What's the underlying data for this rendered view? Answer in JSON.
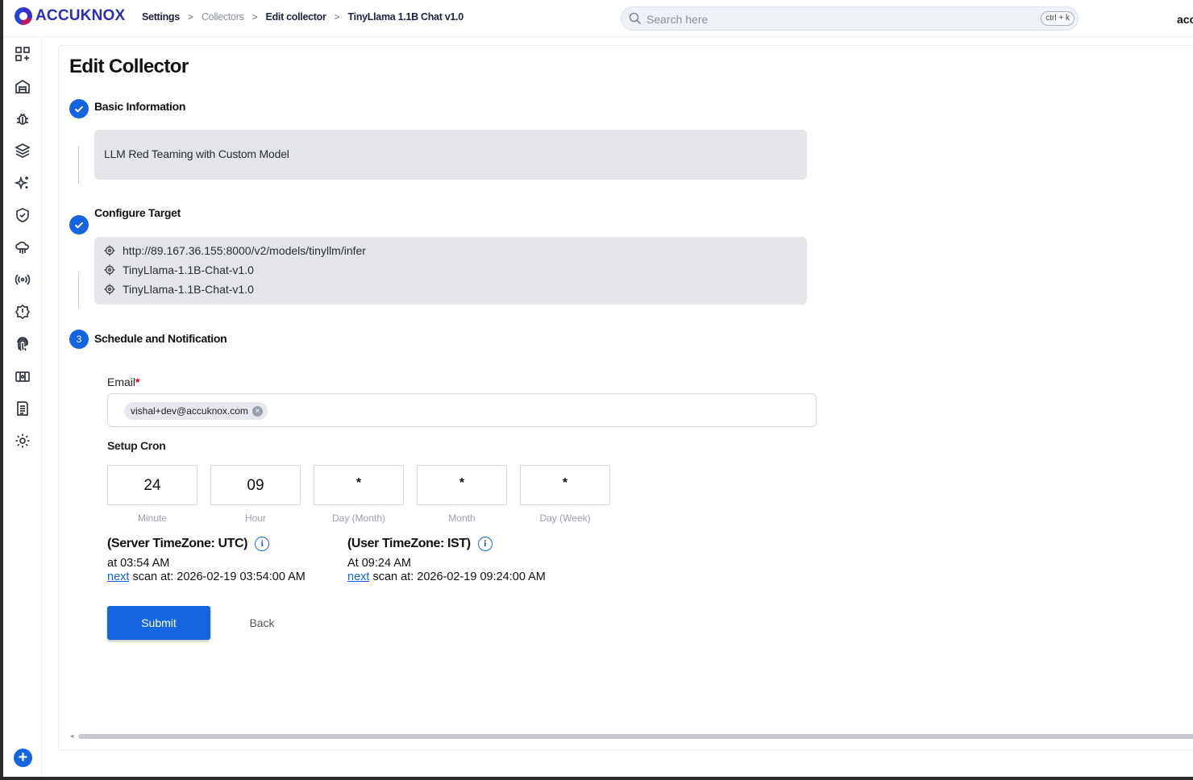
{
  "app": {
    "logo_text": "ACCUKNOX",
    "user_name": "acc"
  },
  "breadcrumb": [
    "Settings",
    "Collectors",
    "Edit collector",
    "TinyLlama 1.1B Chat v1.0"
  ],
  "search": {
    "placeholder": "Search here",
    "shortcut": "ctrl + k"
  },
  "sidebar": {
    "icons": [
      "dashboard-icon",
      "inventory-icon",
      "bug-icon",
      "layers-icon",
      "sparkle-icon",
      "shield-icon",
      "cloud-icon",
      "broadcast-icon",
      "badge-alert-icon",
      "fingerprint-icon",
      "ticket-icon",
      "report-icon",
      "settings-gear-icon"
    ],
    "add_label": "+"
  },
  "page": {
    "title": "Edit Collector"
  },
  "steps": [
    {
      "title": "Basic Information",
      "status": "done",
      "summary": "LLM Red Teaming with Custom Model"
    },
    {
      "title": "Configure Target",
      "status": "done",
      "targets": [
        "http://89.167.36.155:8000/v2/models/tinyllm/infer",
        "TinyLlama-1.1B-Chat-v1.0",
        "TinyLlama-1.1B-Chat-v1.0"
      ]
    },
    {
      "number": "3",
      "title": "Schedule and Notification",
      "status": "active"
    }
  ],
  "form": {
    "email_label": "Email",
    "email_required": "*",
    "emails": [
      "vishal+dev@accuknox.com"
    ],
    "cron_label": "Setup Cron",
    "cron": [
      {
        "value": "24",
        "caption": "Minute"
      },
      {
        "value": "09",
        "caption": "Hour"
      },
      {
        "value": "*",
        "caption": "Day (Month)"
      },
      {
        "value": "*",
        "caption": "Month"
      },
      {
        "value": "*",
        "caption": "Day (Week)"
      }
    ],
    "server_tz": {
      "heading": "(Server TimeZone: UTC)",
      "at": "at 03:54 AM",
      "next_link": "next",
      "next_text": " scan at: 2026-02-19 03:54:00 AM"
    },
    "user_tz": {
      "heading": "(User TimeZone: IST)",
      "at": "At 09:24 AM",
      "next_link": "next",
      "next_text": " scan at: 2026-02-19 09:24:00 AM"
    },
    "submit_label": "Submit",
    "back_label": "Back"
  },
  "colors": {
    "primary": "#1565e0",
    "brand": "#2a2fb8",
    "summary_bg": "#e3e5e9"
  }
}
